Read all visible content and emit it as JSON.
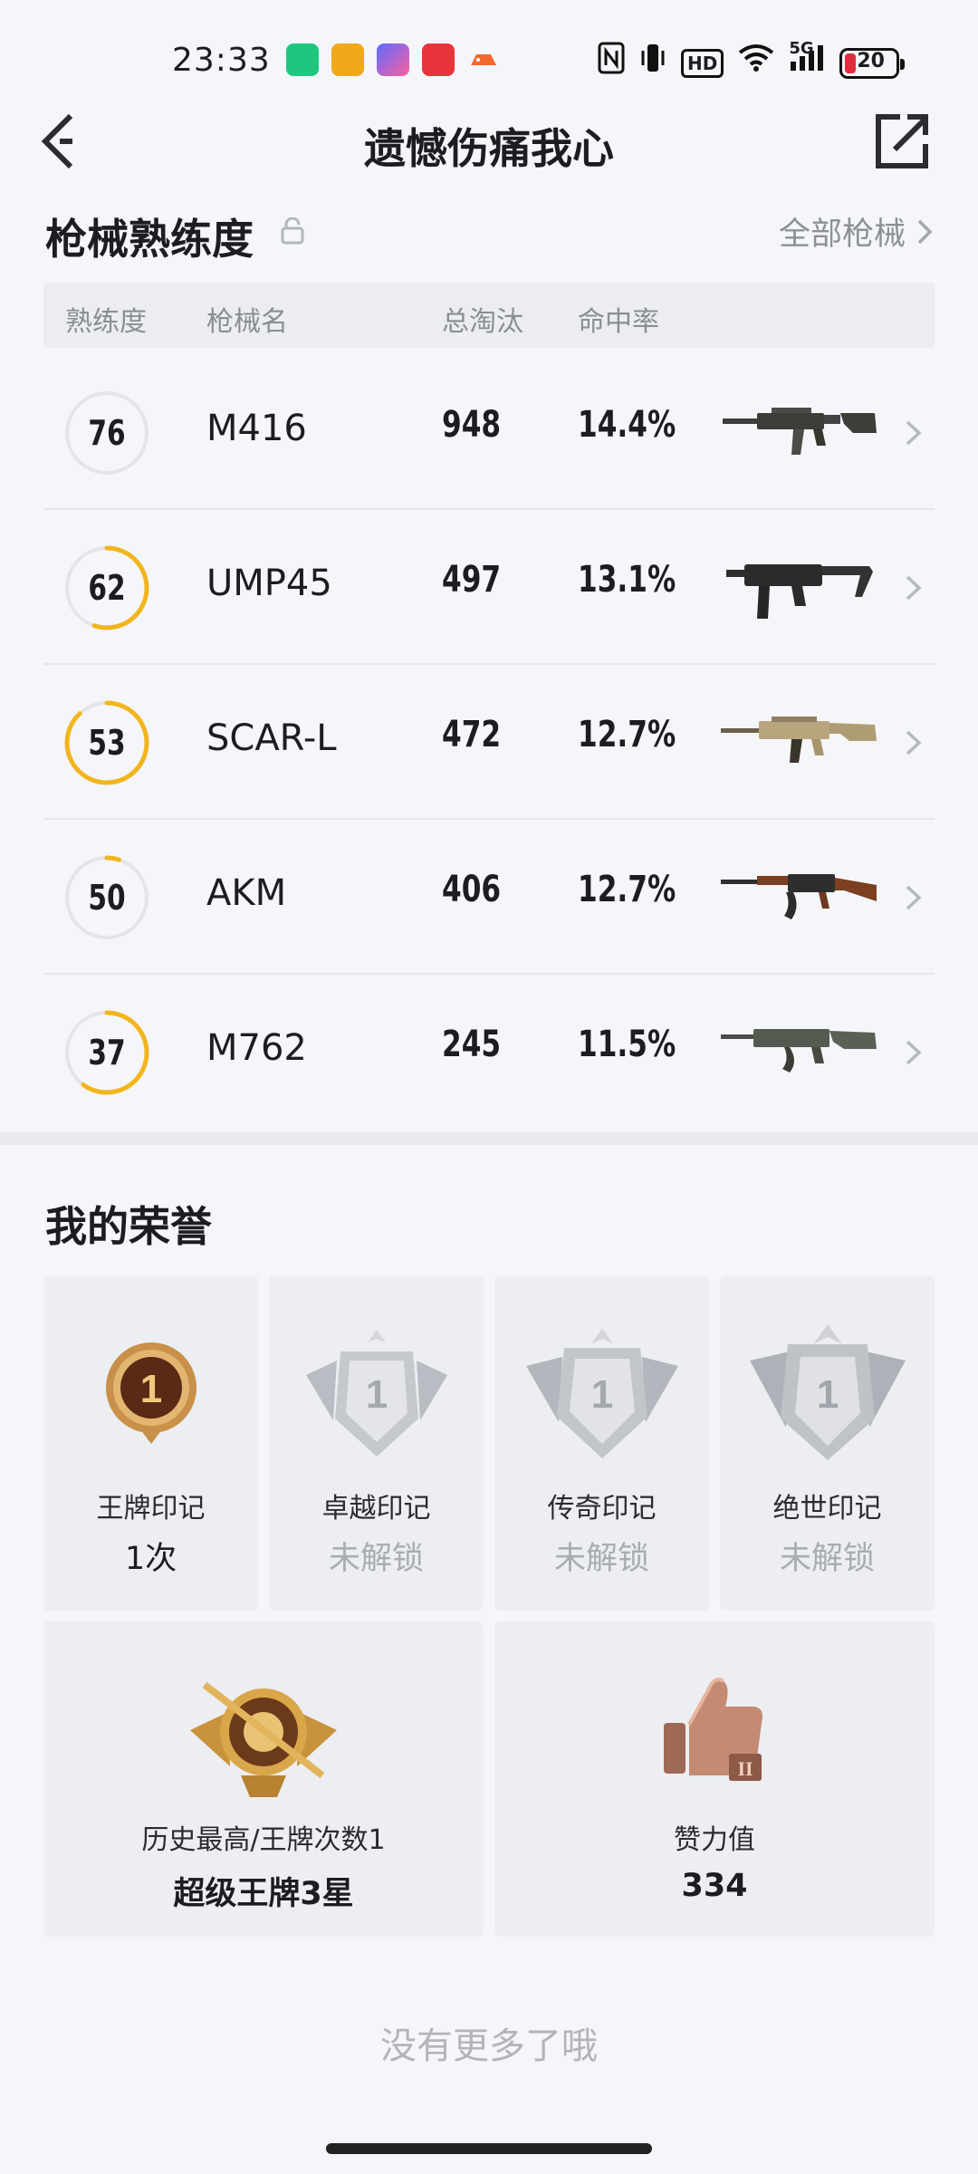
{
  "status_bar": {
    "time": "23:33",
    "network": "5G",
    "hd": "HD",
    "battery": "20"
  },
  "header": {
    "title": "遗憾伤痛我心",
    "back_icon": "chevron-left-icon",
    "share_icon": "share-external-icon"
  },
  "weapons": {
    "section_title": "枪械熟练度",
    "all_link": "全部枪械",
    "columns": [
      "熟练度",
      "枪械名",
      "总淘汰",
      "命中率"
    ],
    "rows": [
      {
        "level": "76",
        "name": "M416",
        "kills": "948",
        "rate": "14.4%",
        "progress": 0.0
      },
      {
        "level": "62",
        "name": "UMP45",
        "kills": "497",
        "rate": "13.1%",
        "progress": 0.55
      },
      {
        "level": "53",
        "name": "SCAR-L",
        "kills": "472",
        "rate": "12.7%",
        "progress": 0.88
      },
      {
        "level": "50",
        "name": "AKM",
        "kills": "406",
        "rate": "12.7%",
        "progress": 0.05
      },
      {
        "level": "37",
        "name": "M762",
        "kills": "245",
        "rate": "11.5%",
        "progress": 0.6
      }
    ],
    "ring_color": "#f2b51c",
    "ring_track": "#e3e5e9"
  },
  "honors": {
    "section_title": "我的荣誉",
    "items": [
      {
        "name": "王牌印记",
        "value": "1次",
        "icon": "ace-medal-icon",
        "locked": false
      },
      {
        "name": "卓越印记",
        "value": "未解锁",
        "icon": "excellent-badge-icon",
        "locked": true
      },
      {
        "name": "传奇印记",
        "value": "未解锁",
        "icon": "legend-badge-icon",
        "locked": true
      },
      {
        "name": "绝世印记",
        "value": "未解锁",
        "icon": "peerless-badge-icon",
        "locked": true
      }
    ],
    "highest": {
      "name": "历史最高/王牌次数1",
      "value": "超级王牌3星",
      "icon": "ace-tier-emblem-icon"
    },
    "likes": {
      "name": "赞力值",
      "value": "334",
      "icon": "thumbs-up-icon"
    }
  },
  "footer": {
    "no_more": "没有更多了哦"
  }
}
